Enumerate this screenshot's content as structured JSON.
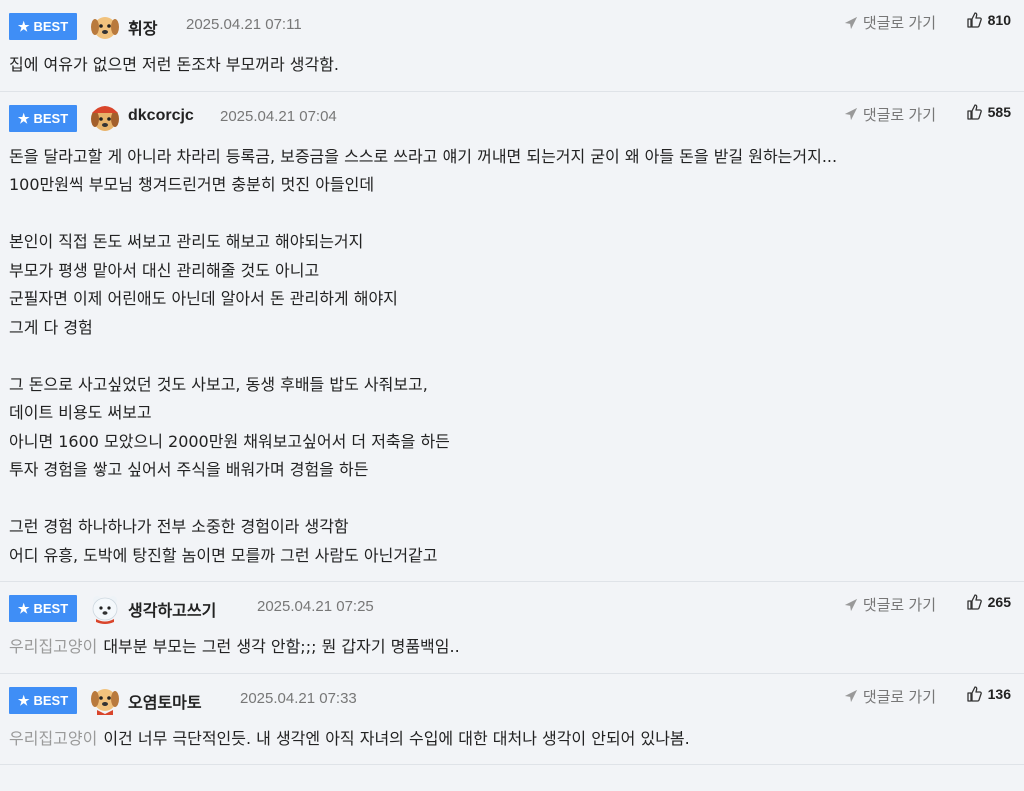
{
  "best_label": "BEST",
  "reply_label": "댓글로 가기",
  "comments": [
    {
      "nick": "휘장",
      "time": "2025.04.21 07:11",
      "likes": "810",
      "quote": "",
      "text": "집에 여유가 없으면 저런 돈조차 부모꺼라 생각함."
    },
    {
      "nick": "dkcorcjc",
      "time": "2025.04.21 07:04",
      "likes": "585",
      "quote": "",
      "text": "돈을 달라고할 게 아니라 차라리 등록금, 보증금을 스스로 쓰라고 얘기 꺼내면 되는거지 굳이 왜 아들 돈을 받길 원하는거지...\n100만원씩 부모님 챙겨드린거면 충분히 멋진 아들인데\n\n본인이 직접 돈도 써보고 관리도 해보고 해야되는거지\n부모가 평생 맡아서 대신 관리해줄 것도 아니고\n군필자면 이제 어린애도 아닌데 알아서 돈 관리하게 해야지\n그게 다 경험\n\n그 돈으로 사고싶었던 것도 사보고, 동생 후배들 밥도 사줘보고,\n데이트 비용도 써보고\n아니면 1600 모았으니 2000만원 채워보고싶어서 더 저축을 하든\n투자 경험을 쌓고 싶어서 주식을 배워가며 경험을 하든\n\n그런 경험 하나하나가 전부 소중한 경험이라 생각함\n어디 유흥, 도박에 탕진할 놈이면 모를까 그런 사람도 아닌거같고"
    },
    {
      "nick": "생각하고쓰기",
      "time": "2025.04.21 07:25",
      "likes": "265",
      "quote": "우리집고양이",
      "text": "대부분 부모는 그런 생각 안함;;; 뭔 갑자기 명품백임.."
    },
    {
      "nick": "오염토마토",
      "time": "2025.04.21 07:33",
      "likes": "136",
      "quote": "우리집고양이",
      "text": "이건 너무 극단적인듯. 내 생각엔 아직 자녀의 수입에 대한 대처나 생각이 안되어 있나봄."
    }
  ]
}
